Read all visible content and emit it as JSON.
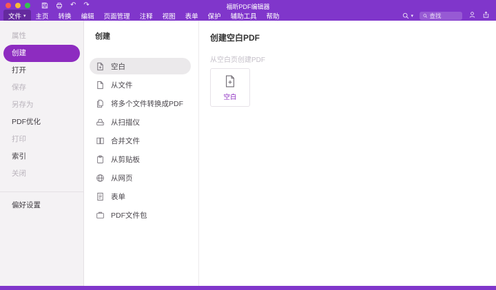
{
  "window": {
    "title": "福昕PDF编辑器"
  },
  "icons": {
    "caret_down": "▾",
    "undo": "↶",
    "redo": "↷"
  },
  "menubar": {
    "items": [
      "文件",
      "主页",
      "转换",
      "编辑",
      "页面管理",
      "注释",
      "视图",
      "表单",
      "保护",
      "辅助工具",
      "帮助"
    ],
    "search_placeholder": "查找"
  },
  "sidebar": {
    "items": [
      {
        "label": "属性",
        "state": "disabled"
      },
      {
        "label": "创建",
        "state": "active"
      },
      {
        "label": "打开",
        "state": "normal"
      },
      {
        "label": "保存",
        "state": "disabled"
      },
      {
        "label": "另存为",
        "state": "disabled"
      },
      {
        "label": "PDF优化",
        "state": "normal"
      },
      {
        "label": "打印",
        "state": "disabled"
      },
      {
        "label": "索引",
        "state": "normal"
      },
      {
        "label": "关闭",
        "state": "disabled"
      }
    ],
    "footer": "偏好设置"
  },
  "create_panel": {
    "title": "创建",
    "items": [
      {
        "label": "空白",
        "selected": true
      },
      {
        "label": "从文件",
        "selected": false
      },
      {
        "label": "将多个文件转换成PDF",
        "selected": false
      },
      {
        "label": "从扫描仪",
        "selected": false
      },
      {
        "label": "合并文件",
        "selected": false
      },
      {
        "label": "从剪贴板",
        "selected": false
      },
      {
        "label": "从网页",
        "selected": false
      },
      {
        "label": "表单",
        "selected": false
      },
      {
        "label": "PDF文件包",
        "selected": false
      }
    ]
  },
  "detail": {
    "title": "创建空白PDF",
    "subtitle": "从空白页创建PDF",
    "card_label": "空白"
  },
  "colors": {
    "accent": "#8036cb",
    "active_pill": "#8d2cc0"
  }
}
